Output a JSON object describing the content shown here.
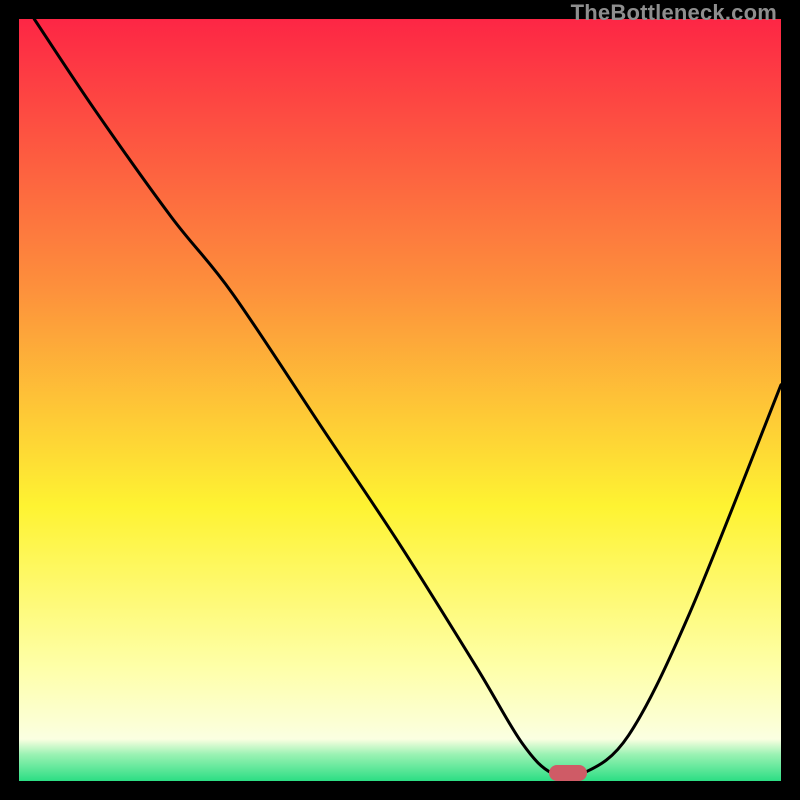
{
  "watermark": "TheBottleneck.com",
  "colors": {
    "top": "#fd2645",
    "mid1": "#fd8f3c",
    "mid2": "#fef332",
    "pale": "#feffa8",
    "green": "#2cde84",
    "line": "#000000",
    "marker": "#cf5b66",
    "bg": "#000000"
  },
  "chart_data": {
    "type": "line",
    "title": "",
    "xlabel": "",
    "ylabel": "",
    "xlim": [
      0,
      100
    ],
    "ylim": [
      0,
      100
    ],
    "x": [
      2,
      10,
      20,
      28,
      40,
      50,
      60,
      66,
      70,
      74,
      80,
      88,
      100
    ],
    "y": [
      100,
      88,
      74,
      64,
      46,
      31,
      15,
      5,
      1,
      1,
      6,
      22,
      52
    ],
    "marker": {
      "x": 72,
      "y": 1,
      "w": 5,
      "h": 2
    },
    "gradient_stops": [
      {
        "pos": 0.0,
        "color": "#fd2645"
      },
      {
        "pos": 0.35,
        "color": "#fd8f3c"
      },
      {
        "pos": 0.64,
        "color": "#fef332"
      },
      {
        "pos": 0.85,
        "color": "#feffa8"
      },
      {
        "pos": 0.945,
        "color": "#fbffe1"
      },
      {
        "pos": 0.965,
        "color": "#9bf2b3"
      },
      {
        "pos": 1.0,
        "color": "#2cde84"
      }
    ]
  }
}
